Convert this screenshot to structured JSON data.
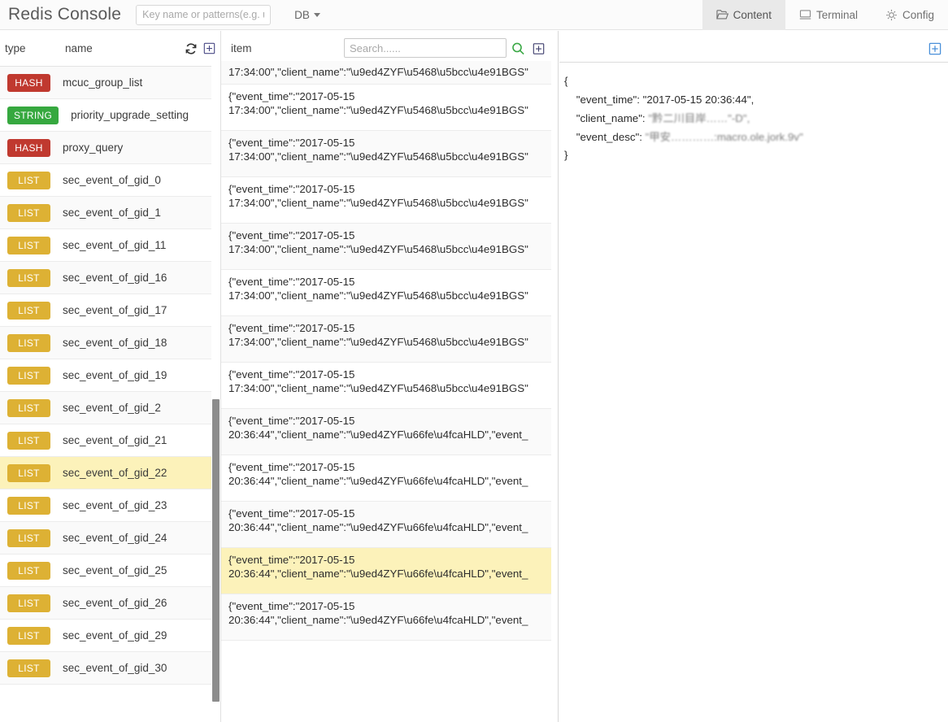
{
  "app": {
    "brand": "Redis Console",
    "key_search_placeholder": "Key name or patterns(e.g. user*)",
    "key_search_value": "",
    "db_label": "DB"
  },
  "nav": {
    "tabs": [
      {
        "label": "Content",
        "icon": "folder-open-icon",
        "active": true
      },
      {
        "label": "Terminal",
        "icon": "monitor-icon",
        "active": false
      },
      {
        "label": "Config",
        "icon": "gear-icon",
        "active": false
      }
    ]
  },
  "sidebar": {
    "columns": {
      "type": "type",
      "name": "name"
    },
    "icons": {
      "refresh": "refresh-icon",
      "add": "add-box-icon"
    },
    "keys": [
      {
        "type": "HASH",
        "name": "mcuc_group_list",
        "selected": false
      },
      {
        "type": "STRING",
        "name": "priority_upgrade_setting",
        "selected": false
      },
      {
        "type": "HASH",
        "name": "proxy_query",
        "selected": false
      },
      {
        "type": "LIST",
        "name": "sec_event_of_gid_0",
        "selected": false
      },
      {
        "type": "LIST",
        "name": "sec_event_of_gid_1",
        "selected": false
      },
      {
        "type": "LIST",
        "name": "sec_event_of_gid_11",
        "selected": false
      },
      {
        "type": "LIST",
        "name": "sec_event_of_gid_16",
        "selected": false
      },
      {
        "type": "LIST",
        "name": "sec_event_of_gid_17",
        "selected": false
      },
      {
        "type": "LIST",
        "name": "sec_event_of_gid_18",
        "selected": false
      },
      {
        "type": "LIST",
        "name": "sec_event_of_gid_19",
        "selected": false
      },
      {
        "type": "LIST",
        "name": "sec_event_of_gid_2",
        "selected": false
      },
      {
        "type": "LIST",
        "name": "sec_event_of_gid_21",
        "selected": false
      },
      {
        "type": "LIST",
        "name": "sec_event_of_gid_22",
        "selected": true
      },
      {
        "type": "LIST",
        "name": "sec_event_of_gid_23",
        "selected": false
      },
      {
        "type": "LIST",
        "name": "sec_event_of_gid_24",
        "selected": false
      },
      {
        "type": "LIST",
        "name": "sec_event_of_gid_25",
        "selected": false
      },
      {
        "type": "LIST",
        "name": "sec_event_of_gid_26",
        "selected": false
      },
      {
        "type": "LIST",
        "name": "sec_event_of_gid_29",
        "selected": false
      },
      {
        "type": "LIST",
        "name": "sec_event_of_gid_30",
        "selected": false
      }
    ]
  },
  "middle": {
    "column_label": "item",
    "search_placeholder": "Search......",
    "search_value": "",
    "icons": {
      "search": "search-icon",
      "add": "add-box-icon"
    },
    "items": [
      {
        "clipped": true,
        "line1": "",
        "line2": "17:34:00\",\"client_name\":\"\\u9ed4ZYF\\u5468\\u5bcc\\u4e91BGS\"",
        "selected": false
      },
      {
        "line1": "{\"event_time\":\"2017-05-15",
        "line2": "17:34:00\",\"client_name\":\"\\u9ed4ZYF\\u5468\\u5bcc\\u4e91BGS\"",
        "selected": false
      },
      {
        "line1": "{\"event_time\":\"2017-05-15",
        "line2": "17:34:00\",\"client_name\":\"\\u9ed4ZYF\\u5468\\u5bcc\\u4e91BGS\"",
        "selected": false
      },
      {
        "line1": "{\"event_time\":\"2017-05-15",
        "line2": "17:34:00\",\"client_name\":\"\\u9ed4ZYF\\u5468\\u5bcc\\u4e91BGS\"",
        "selected": false
      },
      {
        "line1": "{\"event_time\":\"2017-05-15",
        "line2": "17:34:00\",\"client_name\":\"\\u9ed4ZYF\\u5468\\u5bcc\\u4e91BGS\"",
        "selected": false
      },
      {
        "line1": "{\"event_time\":\"2017-05-15",
        "line2": "17:34:00\",\"client_name\":\"\\u9ed4ZYF\\u5468\\u5bcc\\u4e91BGS\"",
        "selected": false
      },
      {
        "line1": "{\"event_time\":\"2017-05-15",
        "line2": "17:34:00\",\"client_name\":\"\\u9ed4ZYF\\u5468\\u5bcc\\u4e91BGS\"",
        "selected": false
      },
      {
        "line1": "{\"event_time\":\"2017-05-15",
        "line2": "17:34:00\",\"client_name\":\"\\u9ed4ZYF\\u5468\\u5bcc\\u4e91BGS\"",
        "selected": false
      },
      {
        "line1": "{\"event_time\":\"2017-05-15",
        "line2": "20:36:44\",\"client_name\":\"\\u9ed4ZYF\\u66fe\\u4fcaHLD\",\"event_",
        "selected": false
      },
      {
        "line1": "{\"event_time\":\"2017-05-15",
        "line2": "20:36:44\",\"client_name\":\"\\u9ed4ZYF\\u66fe\\u4fcaHLD\",\"event_",
        "selected": false
      },
      {
        "line1": "{\"event_time\":\"2017-05-15",
        "line2": "20:36:44\",\"client_name\":\"\\u9ed4ZYF\\u66fe\\u4fcaHLD\",\"event_",
        "selected": false
      },
      {
        "line1": "{\"event_time\":\"2017-05-15",
        "line2": "20:36:44\",\"client_name\":\"\\u9ed4ZYF\\u66fe\\u4fcaHLD\",\"event_",
        "selected": true
      },
      {
        "line1": "{\"event_time\":\"2017-05-15",
        "line2": "20:36:44\",\"client_name\":\"\\u9ed4ZYF\\u66fe\\u4fcaHLD\",\"event_",
        "selected": false
      }
    ]
  },
  "detail": {
    "icons": {
      "add": "add-box-icon"
    },
    "open_brace": "{",
    "close_brace": "}",
    "fields": [
      {
        "key": "\"event_time\":",
        "value": " \"2017-05-15 20:36:44\",",
        "redacted": false
      },
      {
        "key": "\"client_name\":",
        "value": " \"黔二川目岸……\"-D\",",
        "redacted": true
      },
      {
        "key": "\"event_desc\":",
        "value": " \"甲安…………:macro.ole.jork.9v\"",
        "redacted": true
      }
    ]
  },
  "colors": {
    "hash_tag": "#c0392f",
    "string_tag": "#36a83f",
    "list_tag": "#ddb134",
    "selected_row": "#fcf2ba",
    "search_icon": "#3aa845",
    "accent_blue": "#4a90d9"
  }
}
